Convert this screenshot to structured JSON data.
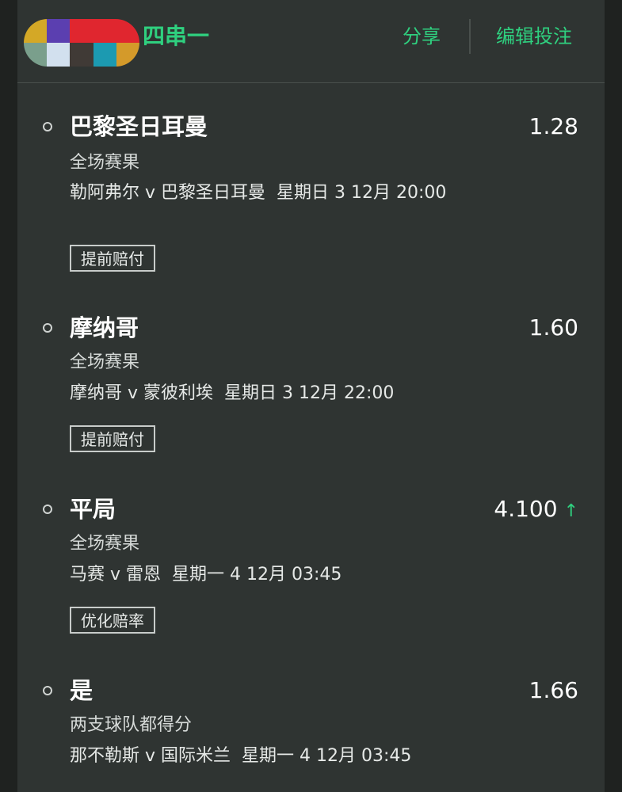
{
  "header": {
    "bet_type": "四串一",
    "share_label": "分享",
    "edit_label": "编辑投注"
  },
  "colors": {
    "accent": "#2fd07f",
    "panel": "#2f3432",
    "background": "#1f2220"
  },
  "avatar": {
    "colors": [
      "#d4a826",
      "#5b3fb0",
      "#e0262f",
      "#e0262f",
      "#e0262f",
      "#7a9f8c",
      "#d2e0ee",
      "#403a36",
      "#1c9ab1",
      "#d49a2a"
    ]
  },
  "selections": [
    {
      "name": "巴黎圣日耳曼",
      "odds": "1.28",
      "market": "全场赛果",
      "event": "勒阿弗尔 v 巴黎圣日耳曼",
      "time": "星期日 3 12月 20:00",
      "tag": "提前赔付"
    },
    {
      "name": "摩纳哥",
      "odds": "1.60",
      "market": "全场赛果",
      "event": "摩纳哥 v 蒙彼利埃",
      "time": "星期日 3 12月 22:00",
      "tag": "提前赔付"
    },
    {
      "name": "平局",
      "odds": "4.100",
      "odds_trend": "↑",
      "market": "全场赛果",
      "event": "马赛 v 雷恩",
      "time": "星期一 4 12月 03:45",
      "tag": "优化赔率"
    },
    {
      "name": "是",
      "odds": "1.66",
      "market": "两支球队都得分",
      "event": "那不勒斯 v 国际米兰",
      "time": "星期一 4 12月 03:45"
    }
  ]
}
